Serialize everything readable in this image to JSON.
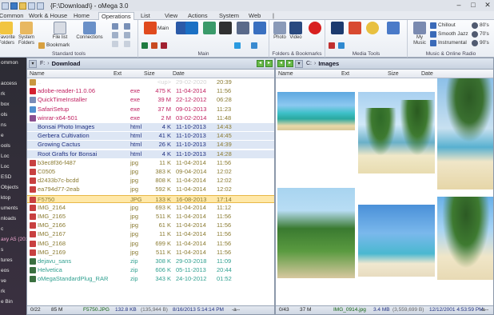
{
  "window": {
    "title": "{F:\\Download\\} - oMega 3.0",
    "buttons": [
      "–",
      "□",
      "✕"
    ]
  },
  "ribbon_tabs": [
    "Common",
    "Work & House",
    "Home",
    "Operations",
    "List",
    "View",
    "Actions",
    "System",
    "Web",
    "|"
  ],
  "ribbon": {
    "standard_tools": {
      "label": "Standard tools",
      "favorite": "Favorite Folders",
      "system": "System Folders",
      "file_list": "File list",
      "connections": "Connections",
      "bookmark": "Bookmark"
    },
    "main": {
      "label": "Main",
      "main_btn": "Main"
    },
    "folders_bookmarks": {
      "label": "Folders & Bookmarks",
      "photo": "Photo",
      "video": "Video"
    },
    "media_tools": {
      "label": "Media Tools"
    },
    "music": {
      "label": "Music & Online Radio",
      "my_music": "My Music",
      "stations": [
        "Chillout",
        "Smooth Jazz",
        "Instrumental"
      ],
      "decades": [
        "80's",
        "70's",
        "90's"
      ]
    }
  },
  "leftnav": {
    "items": [
      "ommon",
      "",
      "access",
      "rk",
      "box",
      "ols",
      "ns",
      "e",
      "ools",
      "Loc",
      "Loc",
      "ESD",
      "Objects",
      "ktop",
      "uments",
      "nloads",
      "c",
      "axy A5 (201",
      "s",
      "tures",
      "eos",
      "ve",
      "rk",
      "e Bin"
    ]
  },
  "left_panel": {
    "drive": "F:",
    "path": "Download",
    "columns": {
      "name": "Name",
      "ext": "Ext",
      "size": "Size",
      "date": "Date"
    },
    "files": [
      {
        "name": "..",
        "ext": "",
        "size": "<up>",
        "date": "29-02-2020",
        "time": "20:39",
        "color": "#d4d4d4",
        "icon": "#c89840"
      },
      {
        "name": "adobe-reader-11.0.06",
        "ext": "exe",
        "size": "475 K",
        "date": "11-04-2014",
        "time": "11:56",
        "color": "#c02060",
        "icon": "#d42030"
      },
      {
        "name": "QuickTimeInstaller",
        "ext": "exe",
        "size": "39 M",
        "date": "22-12-2012",
        "time": "06:28",
        "color": "#c02060",
        "icon": "#7a8cb8"
      },
      {
        "name": "SafariSetup",
        "ext": "exe",
        "size": "37 M",
        "date": "09-01-2013",
        "time": "11:23",
        "color": "#c02060",
        "icon": "#5090d0"
      },
      {
        "name": "winrar-x64-501",
        "ext": "exe",
        "size": "2 M",
        "date": "03-02-2014",
        "time": "11:48",
        "color": "#c02060",
        "icon": "#8a5090"
      },
      {
        "name": "Bonsai Photo Images",
        "ext": "html",
        "size": "4 K",
        "date": "11-10-2013",
        "time": "14:43",
        "color": "#203080",
        "icon": ""
      },
      {
        "name": "Gerbera Cultivation",
        "ext": "html",
        "size": "41 K",
        "date": "11-10-2013",
        "time": "14:45",
        "color": "#203080",
        "icon": ""
      },
      {
        "name": "Growing Cactus",
        "ext": "html",
        "size": "26 K",
        "date": "11-10-2013",
        "time": "14:39",
        "color": "#203080",
        "icon": ""
      },
      {
        "name": "Root Grafts for Bonsai",
        "ext": "html",
        "size": "4 K",
        "date": "11-10-2013",
        "time": "14:28",
        "color": "#203080",
        "icon": ""
      },
      {
        "name": "b3ec8f36-f487",
        "ext": "jpg",
        "size": "11 K",
        "date": "11-04-2014",
        "time": "11:56",
        "color": "#8a7a30",
        "icon": "#c84040"
      },
      {
        "name": "C0505",
        "ext": "jpg",
        "size": "383 K",
        "date": "09-04-2014",
        "time": "12:02",
        "color": "#8a7a30",
        "icon": "#c84040"
      },
      {
        "name": "d2433b7c-bcdd",
        "ext": "jpg",
        "size": "808 K",
        "date": "11-04-2014",
        "time": "12:02",
        "color": "#8a7a30",
        "icon": "#c84040"
      },
      {
        "name": "ea794d77-2eab",
        "ext": "jpg",
        "size": "592 K",
        "date": "11-04-2014",
        "time": "12:02",
        "color": "#8a7a30",
        "icon": "#c84040"
      },
      {
        "name": "F5750",
        "ext": "JPG",
        "size": "133 K",
        "date": "16-08-2013",
        "time": "17:14",
        "color": "#8a7a30",
        "icon": "#c84040"
      },
      {
        "name": "IMG_2164",
        "ext": "jpg",
        "size": "693 K",
        "date": "11-04-2014",
        "time": "11:12",
        "color": "#8a7a30",
        "icon": "#c84040"
      },
      {
        "name": "IMG_2165",
        "ext": "jpg",
        "size": "511 K",
        "date": "11-04-2014",
        "time": "11:56",
        "color": "#8a7a30",
        "icon": "#c84040"
      },
      {
        "name": "IMG_2166",
        "ext": "jpg",
        "size": "61 K",
        "date": "11-04-2014",
        "time": "11:56",
        "color": "#8a7a30",
        "icon": "#c84040"
      },
      {
        "name": "IMG_2167",
        "ext": "jpg",
        "size": "11 K",
        "date": "11-04-2014",
        "time": "11:56",
        "color": "#8a7a30",
        "icon": "#c84040"
      },
      {
        "name": "IMG_2168",
        "ext": "jpg",
        "size": "699 K",
        "date": "11-04-2014",
        "time": "11:56",
        "color": "#8a7a30",
        "icon": "#c84040"
      },
      {
        "name": "IMG_2169",
        "ext": "jpg",
        "size": "511 K",
        "date": "11-04-2014",
        "time": "11:56",
        "color": "#8a7a30",
        "icon": "#c84040"
      },
      {
        "name": "dejavu_sans",
        "ext": "zip",
        "size": "308 K",
        "date": "29-03-2018",
        "time": "11:09",
        "color": "#30a090",
        "icon": "#3a7040"
      },
      {
        "name": "Helvetica",
        "ext": "zip",
        "size": "606 K",
        "date": "05-11-2013",
        "time": "20:44",
        "color": "#30a090",
        "icon": "#3a7040"
      },
      {
        "name": "oMegaStandardPlug_RAR",
        "ext": "zip",
        "size": "343 K",
        "date": "24-10-2012",
        "time": "01:52",
        "color": "#30a090",
        "icon": "#3a7040"
      }
    ],
    "status": {
      "count": "0/22",
      "selected_size": "85 M",
      "current_file": "F5750.JPG",
      "file_size": "132.8 KB",
      "bytes": "(135,944 B)",
      "date": "8/16/2013 5:14:14 PM",
      "attr": "-a--"
    }
  },
  "right_panel": {
    "drive": "C:",
    "path": "Images",
    "columns": {
      "name": "Name",
      "ext": "Ext",
      "size": "Size",
      "date": "Date"
    },
    "status": {
      "count": "0/43",
      "selected_size": "37 M",
      "current_file": "IMG_0914.jpg",
      "file_size": "3.4 MB",
      "bytes": "(3,559,699 B)",
      "date": "12/12/2001 4:53:59 PM",
      "attr": "-a--"
    }
  },
  "colors": {
    "selection_bg": "#ffe8a8",
    "nav_bg": "#2c2c34"
  }
}
